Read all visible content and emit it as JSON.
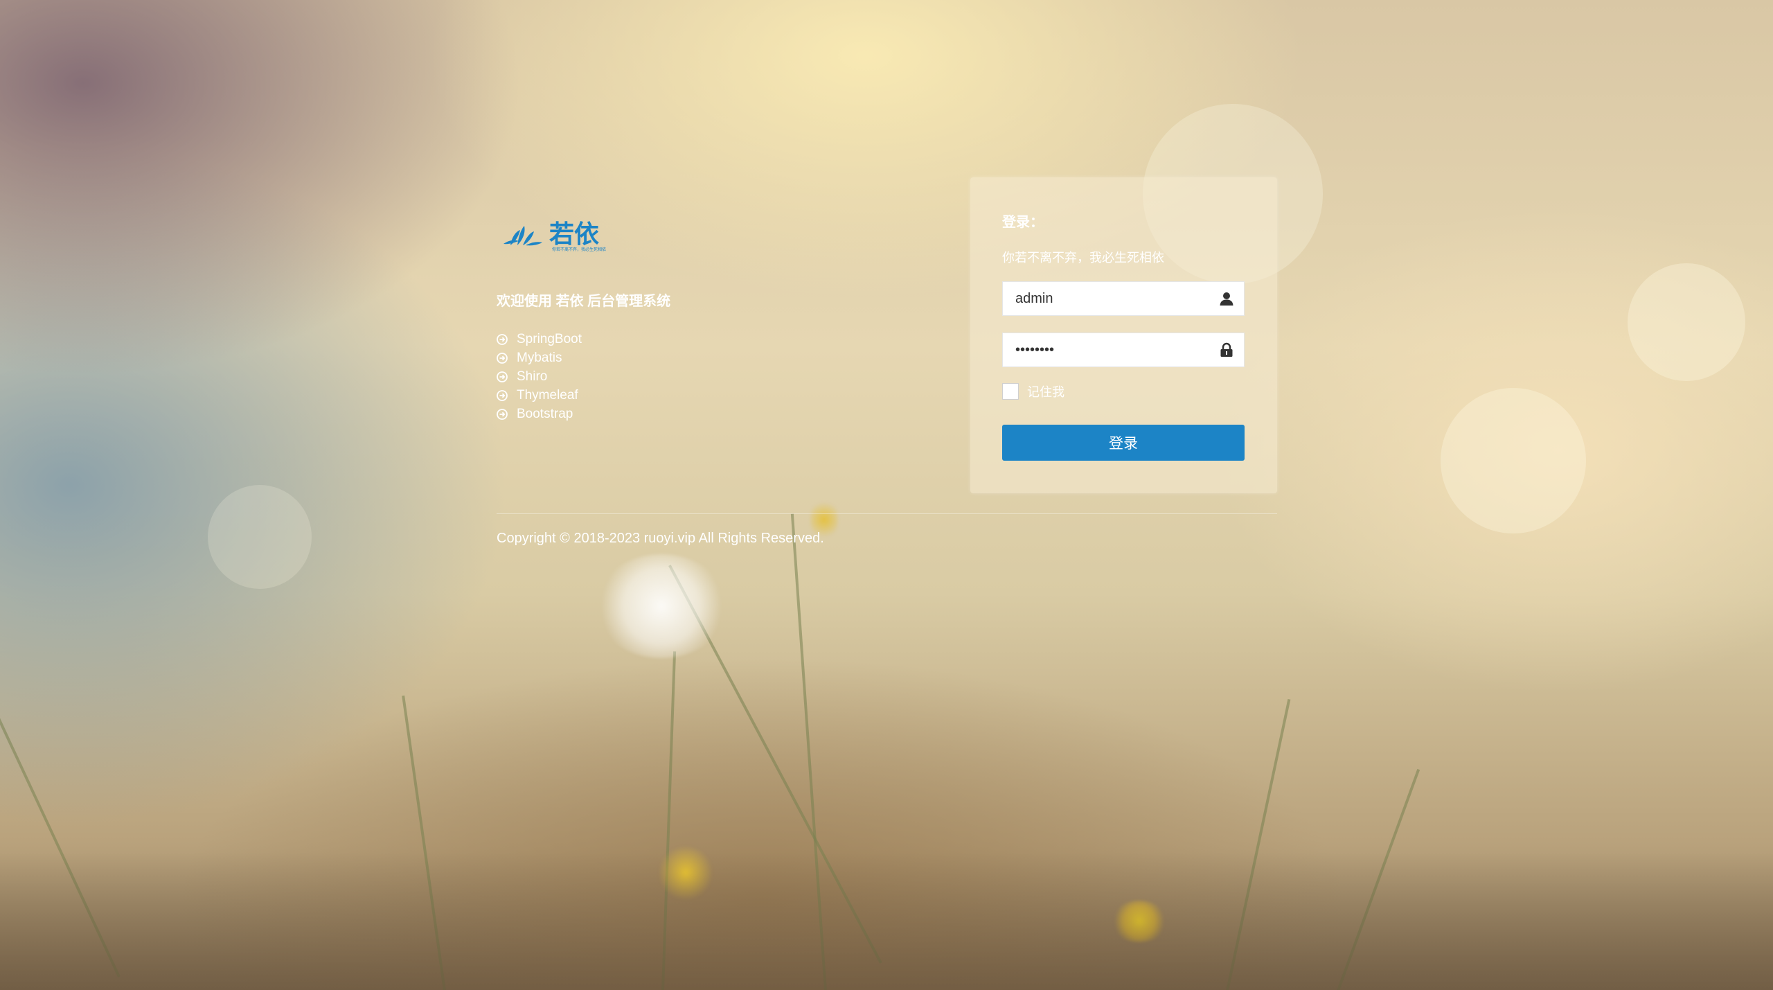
{
  "brand": {
    "logo_name": "若依",
    "logo_tagline": "你若不离不弃，我必生死相依"
  },
  "left": {
    "welcome": "欢迎使用 若依 后台管理系统",
    "features": [
      "SpringBoot",
      "Mybatis",
      "Shiro",
      "Thymeleaf",
      "Bootstrap"
    ],
    "feature_icon": "arrow-circle-right-icon"
  },
  "login": {
    "title": "登录：",
    "subtitle": "你若不离不弃，我必生死相依",
    "username": {
      "value": "admin",
      "icon": "user-icon"
    },
    "password": {
      "value": "admin123",
      "icon": "lock-icon"
    },
    "remember_label": "记住我",
    "remember_checked": false,
    "submit_label": "登录"
  },
  "footer": {
    "copyright": "Copyright © 2018-2023 ruoyi.vip All Rights Reserved."
  },
  "colors": {
    "primary": "#1c84c6",
    "logo": "#1c84c6"
  }
}
